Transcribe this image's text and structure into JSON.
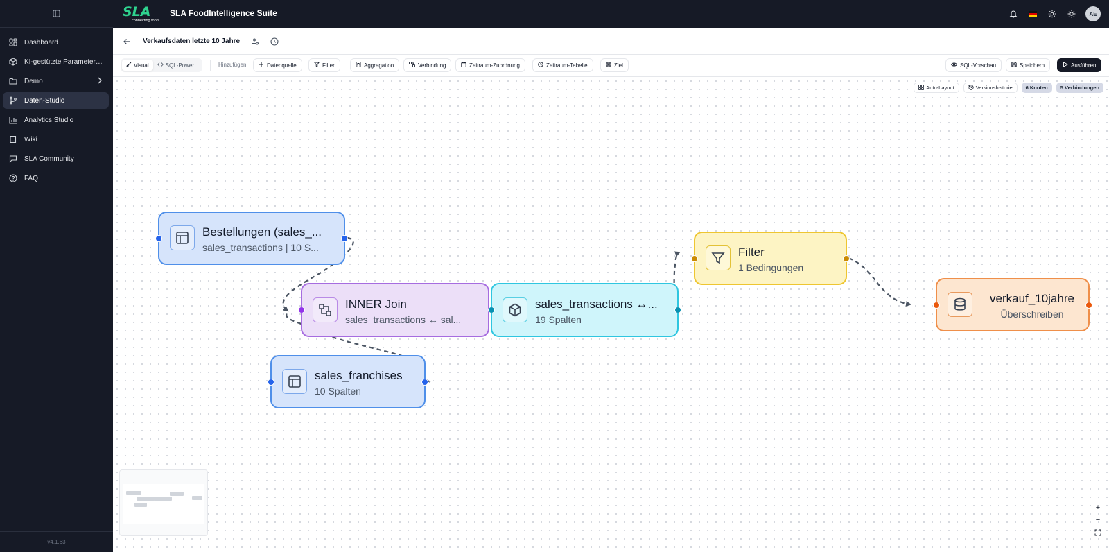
{
  "app": {
    "title": "SLA FoodIntelligence Suite",
    "logo_text": "SLA",
    "logo_tagline": "connecting food",
    "version": "v4.1.63"
  },
  "sidebar": {
    "items": [
      {
        "label": "Dashboard",
        "icon": "dashboard-icon"
      },
      {
        "label": "KI-gestützte Parameterer...",
        "icon": "cube-icon"
      },
      {
        "label": "Demo",
        "icon": "folder-icon"
      },
      {
        "label": "Daten-Studio",
        "icon": "branch-icon",
        "active": true
      },
      {
        "label": "Analytics Studio",
        "icon": "bar-chart-icon"
      },
      {
        "label": "Wiki",
        "icon": "book-icon"
      },
      {
        "label": "SLA Community",
        "icon": "chat-icon"
      },
      {
        "label": "FAQ",
        "icon": "help-icon"
      }
    ]
  },
  "header": {
    "avatar_initials": "AE"
  },
  "page": {
    "title": "Verkaufsdaten letzte 10 Jahre"
  },
  "toolbar": {
    "mode_visual": "Visual",
    "mode_sql": "SQL-Power",
    "add_label": "Hinzufügen:",
    "add_buttons": [
      "Datenquelle",
      "Filter",
      "Aggregation",
      "Verbindung",
      "Zeitraum-Zuordnung",
      "Zeitraum-Tabelle",
      "Ziel"
    ],
    "sql_preview": "SQL-Vorschau",
    "save": "Speichern",
    "run": "Ausführen"
  },
  "canvas": {
    "auto_layout": "Auto-Layout",
    "version_history": "Versionshistorie",
    "nodes_count": "6 Knoten",
    "edges_count": "5 Verbindungen",
    "zoom_in": "+",
    "zoom_out": "−"
  },
  "nodes": [
    {
      "id": "bestellungen",
      "title": "Bestellungen (sales_...",
      "subtitle": "sales_transactions | 10 S...",
      "type": "source",
      "icon": "table-icon"
    },
    {
      "id": "join",
      "title": "INNER Join",
      "subtitle": "sales_transactions ↔ sal...",
      "type": "join",
      "icon": "join-icon"
    },
    {
      "id": "franchises",
      "title": "sales_franchises",
      "subtitle": "10 Spalten",
      "type": "source",
      "icon": "table-icon"
    },
    {
      "id": "combined",
      "title": "sales_transactions ↔...",
      "subtitle": "19 Spalten",
      "type": "transform",
      "icon": "package-icon"
    },
    {
      "id": "filter",
      "title": "Filter",
      "subtitle": "1 Bedingungen",
      "type": "filter",
      "icon": "filter-icon"
    },
    {
      "id": "target",
      "title": "verkauf_10jahre",
      "subtitle": "Überschreiben",
      "type": "target",
      "icon": "database-icon"
    }
  ],
  "colors": {
    "source_bg": "#d6e4fb",
    "source_border": "#4f8fe9",
    "join_bg": "#ecdff8",
    "join_border": "#a66ce0",
    "transform_bg": "#cff5fb",
    "transform_border": "#2fc6e0",
    "filter_bg": "#fdf4c4",
    "filter_border": "#eec631",
    "target_bg": "#fde6d0",
    "target_border": "#ef8f4a"
  }
}
